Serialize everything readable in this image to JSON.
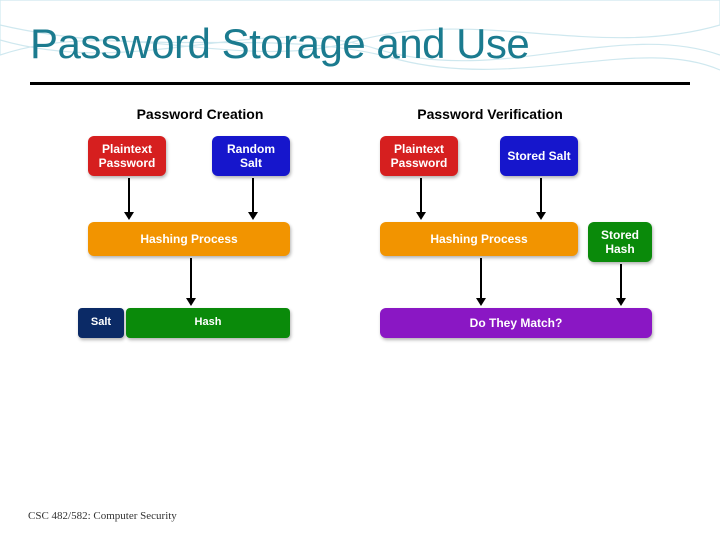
{
  "title": "Password Storage and Use",
  "footer": "CSC 482/582: Computer Security",
  "headings": {
    "creation": "Password Creation",
    "verification": "Password Verification"
  },
  "boxes": {
    "plaintext1": "Plaintext\nPassword",
    "randomSalt": "Random\nSalt",
    "hashing1": "Hashing Process",
    "salt": "Salt",
    "hash": "Hash",
    "plaintext2": "Plaintext\nPassword",
    "storedSalt": "Stored\nSalt",
    "hashing2": "Hashing Process",
    "storedHash": "Stored\nHash",
    "match": "Do They Match?"
  },
  "colors": {
    "red": "#d61f1f",
    "blue": "#1616cc",
    "orange": "#f29400",
    "navy": "#0b2a66",
    "green": "#0a8a0a",
    "purple": "#8a17c4"
  }
}
